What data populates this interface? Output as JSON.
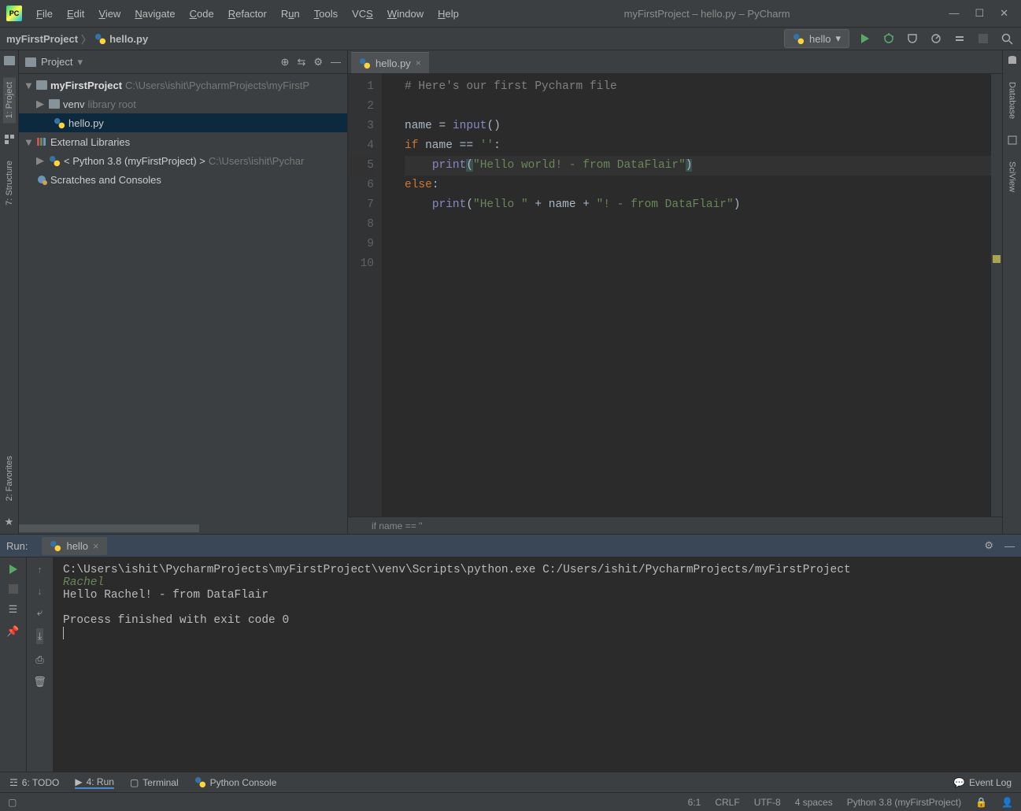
{
  "window": {
    "title": "myFirstProject – hello.py – PyCharm"
  },
  "menu": [
    "File",
    "Edit",
    "View",
    "Navigate",
    "Code",
    "Refactor",
    "Run",
    "Tools",
    "VCS",
    "Window",
    "Help"
  ],
  "breadcrumb": {
    "project": "myFirstProject",
    "file": "hello.py"
  },
  "runConfig": {
    "selected": "hello"
  },
  "projectPanel": {
    "title": "Project",
    "tree": {
      "rootName": "myFirstProject",
      "rootPath": "C:\\Users\\ishit\\PycharmProjects\\myFirstP",
      "venv": "venv",
      "venvNote": "library root",
      "file": "hello.py",
      "external": "External Libraries",
      "externalPy": "< Python 3.8 (myFirstProject) >",
      "externalPyPath": "C:\\Users\\ishit\\Pychar",
      "scratches": "Scratches and Consoles"
    }
  },
  "leftTabs": {
    "project": "1: Project",
    "structure": "7: Structure",
    "favorites": "2: Favorites"
  },
  "rightTabs": {
    "database": "Database",
    "sciview": "SciView"
  },
  "editor": {
    "tab": "hello.py",
    "lines": [
      "1",
      "2",
      "3",
      "4",
      "5",
      "6",
      "7",
      "8",
      "9",
      "10"
    ],
    "code": {
      "l1_comment": "# Here's our first Pycharm file",
      "l3_name": "name = ",
      "l3_input": "input",
      "l3_paren": "()",
      "l4_if": "if",
      "l4_cond": " name == ",
      "l4_str": "''",
      "l4_colon": ":",
      "l5_print": "print",
      "l5_open": "(",
      "l5_str": "\"Hello world! - from DataFlair\"",
      "l5_close": ")",
      "l6_else": "else",
      "l6_colon": ":",
      "l7_print": "print",
      "l7_open": "(",
      "l7_s1": "\"Hello \"",
      "l7_plus1": " + name + ",
      "l7_s2": "\"! - from DataFlair\"",
      "l7_close": ")"
    },
    "breadcrumbContext": "if name == ''"
  },
  "runPanel": {
    "title": "Run:",
    "tab": "hello",
    "console": {
      "cmd": "C:\\Users\\ishit\\PycharmProjects\\myFirstProject\\venv\\Scripts\\python.exe C:/Users/ishit/PycharmProjects/myFirstProject",
      "input": "Rachel",
      "output": "Hello Rachel! - from DataFlair",
      "exit": "Process finished with exit code 0"
    }
  },
  "bottomTools": {
    "todo": "6: TODO",
    "run": "4: Run",
    "terminal": "Terminal",
    "pyconsole": "Python Console",
    "eventlog": "Event Log"
  },
  "status": {
    "pos": "6:1",
    "lineEnding": "CRLF",
    "encoding": "UTF-8",
    "indent": "4 spaces",
    "interpreter": "Python 3.8 (myFirstProject)"
  }
}
